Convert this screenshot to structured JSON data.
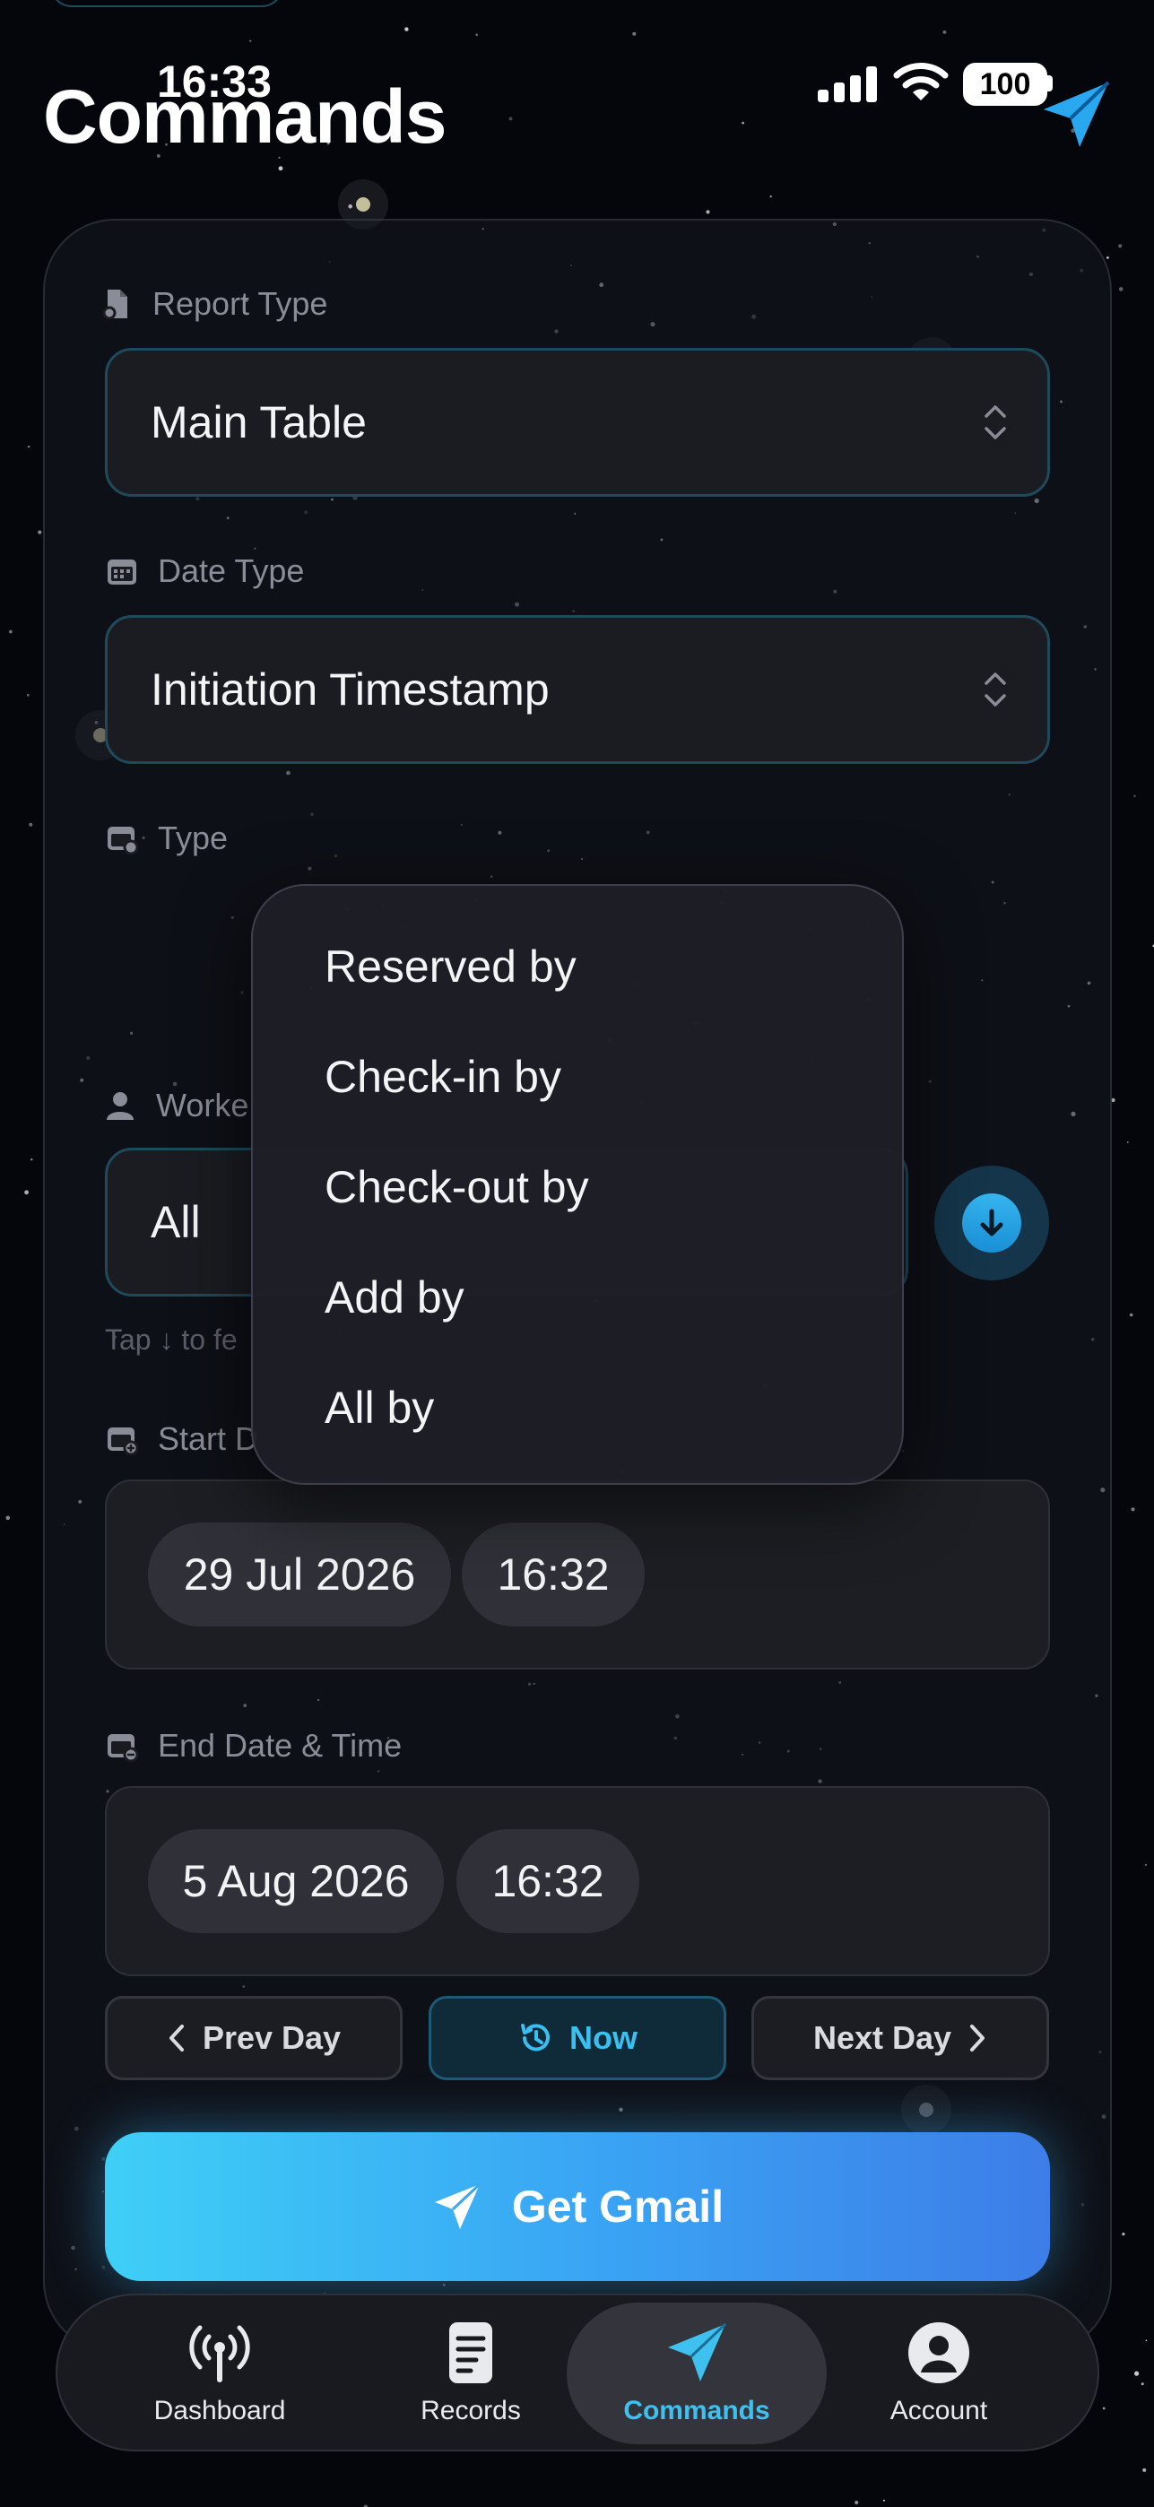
{
  "status_bar": {
    "time": "16:33",
    "battery": "100"
  },
  "page": {
    "title": "Commands"
  },
  "form": {
    "report_type": {
      "label": "Report Type",
      "value": "Main Table"
    },
    "date_type": {
      "label": "Date Type",
      "value": "Initiation Timestamp"
    },
    "type": {
      "label": "Type"
    },
    "worker": {
      "label": "Worke",
      "value": "All",
      "hint": "Tap ↓ to fe"
    },
    "start": {
      "label": "Start D",
      "date": "29 Jul 2026",
      "time": "16:32"
    },
    "end": {
      "label": "End Date & Time",
      "date": "5 Aug 2026",
      "time": "16:32"
    },
    "buttons": {
      "prev_day": "Prev Day",
      "now": "Now",
      "next_day": "Next Day"
    },
    "submit": "Get Gmail"
  },
  "type_menu": {
    "options": [
      "Reserved by",
      "Check-in by",
      "Check-out by",
      "Add by",
      "All by"
    ]
  },
  "tabbar": {
    "items": [
      {
        "label": "Dashboard",
        "icon": "antenna-icon"
      },
      {
        "label": "Records",
        "icon": "document-icon"
      },
      {
        "label": "Commands",
        "icon": "paper-plane-icon"
      },
      {
        "label": "Account",
        "icon": "person-circle-icon"
      }
    ],
    "active": "Commands"
  },
  "colors": {
    "accent": "#3fc1ef",
    "background": "#04060c",
    "field_border": "#1f4a5c"
  }
}
